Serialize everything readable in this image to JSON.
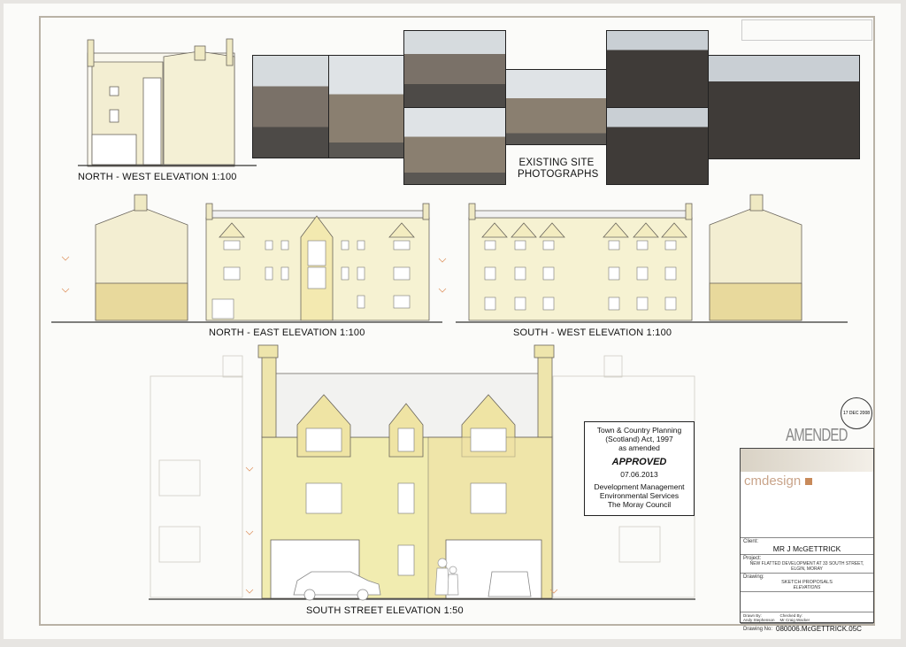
{
  "drawing_labels": {
    "nw_elevation": "NORTH - WEST ELEVATION 1:100",
    "ne_elevation": "NORTH - EAST ELEVATION 1:100",
    "sw_elevation": "SOUTH - WEST ELEVATION 1:100",
    "south_street": "SOUTH STREET ELEVATION 1:50",
    "photos_title_1": "EXISTING SITE",
    "photos_title_2": "PHOTOGRAPHS"
  },
  "approval": {
    "line1": "Town & Country Planning",
    "line2": "(Scotland) Act, 1997",
    "line3": "as amended",
    "status": "APPROVED",
    "date": "07.06.2013",
    "dept1": "Development Management",
    "dept2": "Environmental Services",
    "council": "The Moray Council"
  },
  "amended_stamp": "AMENDED",
  "received_stamp": "17 DEC 2008",
  "title_block": {
    "firm": "cmdesign",
    "client_label": "Client:",
    "client": "MR J McGETTRICK",
    "project_label": "Project:",
    "project": "NEW FLATTED DEVELOPMENT AT 33 SOUTH STREET, ELGIN, MORAY",
    "drawing_label": "Drawing:",
    "drawing": "SKETCH PROPOSALS",
    "drawing_sub": "ELEVATIONS",
    "drawn_label": "Drawn By:",
    "drawn": "Andy Stephenson",
    "checked_label": "Checked By:",
    "checked": "Mr Craig Wacker",
    "drawing_no_label": "Drawing No:",
    "drawing_no": "080006.McGETTRICK.05C"
  },
  "colors": {
    "fill_yellow": "#f1edb4",
    "fill_tan": "#e6d79a",
    "line": "#6a655c"
  }
}
